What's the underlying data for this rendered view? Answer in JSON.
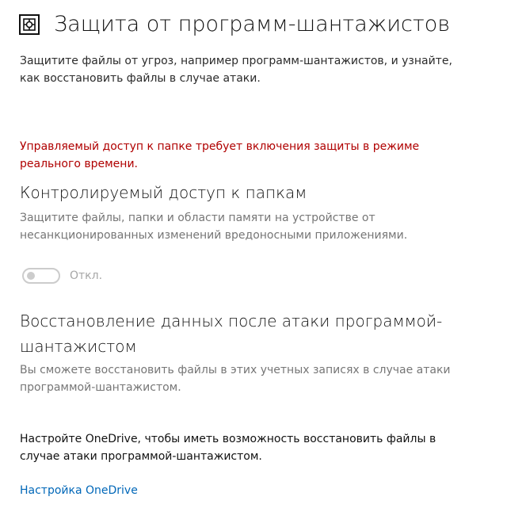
{
  "header": {
    "icon": "ransomware-protection-icon",
    "title": "Защита от программ-шантажистов"
  },
  "intro": {
    "text": "Защитите файлы от угроз, например программ-шантажистов, и узнайте, как восстановить файлы в случае атаки."
  },
  "warning": {
    "text": "Управляемый доступ к папке требует включения защиты в режиме реального времени.",
    "color": "#b00000"
  },
  "controlled_folder_access": {
    "title": "Контролируемый доступ к папкам",
    "description": "Защитите файлы, папки и области памяти на устройстве от несанкционированных изменений вредоносными приложениями.",
    "toggle_state": "off",
    "toggle_label": "Откл."
  },
  "recovery": {
    "title": "Восстановление данных после атаки программой-шантажистом",
    "description": "Вы сможете восстановить файлы в этих учетных записях в случае атаки программой-шантажистом.",
    "onedrive_prompt": "Настройте OneDrive, чтобы иметь возможность восстановить файлы в случае атаки программой-шантажистом.",
    "setup_link": "Настройка OneDrive",
    "link_color": "#0067b8"
  }
}
